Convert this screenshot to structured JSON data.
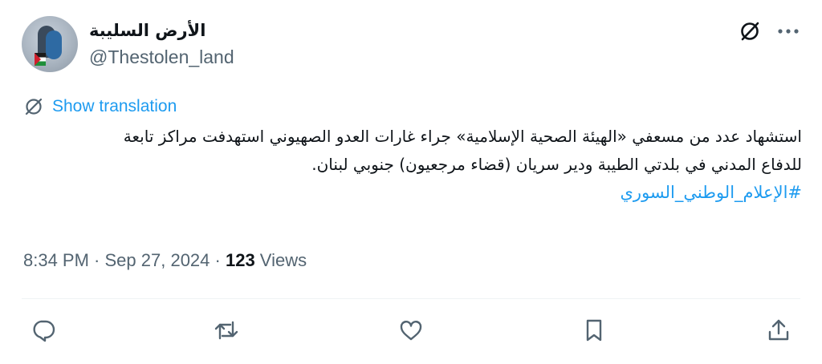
{
  "user": {
    "display_name": "الأرض السليبة",
    "handle": "@Thestolen_land"
  },
  "header": {
    "grok_icon": "slashed-circle-icon",
    "more_icon": "more-dots-icon"
  },
  "translate": {
    "icon": "translate-globe-icon",
    "label": "Show translation"
  },
  "tweet": {
    "line1": "استشهاد عدد من مسعفي «الهيئة الصحية الإسلامية» جراء غارات العدو الصهيوني استهدفت مراكز تابعة",
    "line2": "للدفاع المدني في بلدتي الطيبة ودير سريان (قضاء مرجعيون) جنوبي لبنان.",
    "hashtag": "#الإعلام_الوطني_السوري"
  },
  "meta": {
    "time": "8:34 PM",
    "separator1": " · ",
    "date": "Sep 27, 2024",
    "separator2": " · ",
    "views_count": "123",
    "views_label": " Views"
  },
  "actions": [
    {
      "name": "reply",
      "icon": "reply-icon"
    },
    {
      "name": "repost",
      "icon": "repost-icon"
    },
    {
      "name": "like",
      "icon": "heart-icon"
    },
    {
      "name": "bookmark",
      "icon": "bookmark-icon"
    },
    {
      "name": "share",
      "icon": "share-icon"
    }
  ],
  "colors": {
    "link": "#1d9bf0",
    "text": "#0f1419",
    "secondary": "#536471",
    "divider": "#eff3f4"
  }
}
